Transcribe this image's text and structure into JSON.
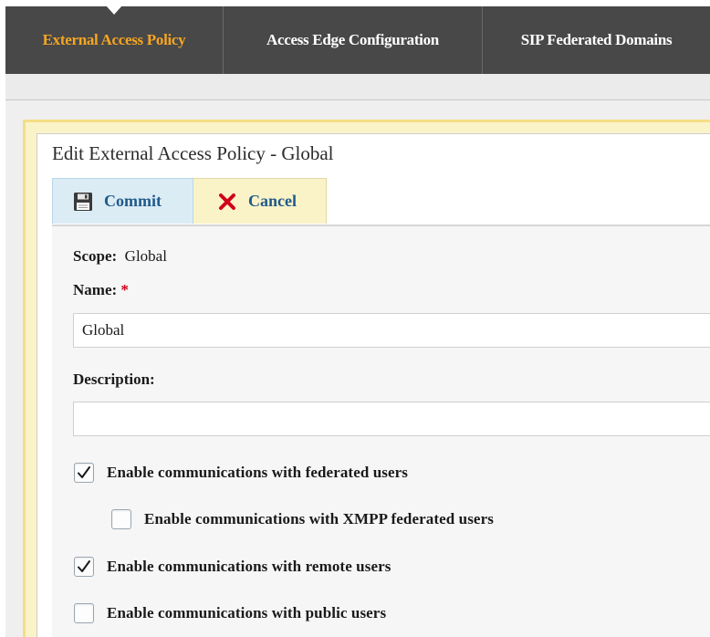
{
  "tabs": [
    {
      "label": "External Access Policy",
      "active": true
    },
    {
      "label": "Access Edge Configuration",
      "active": false
    },
    {
      "label": "SIP Federated Domains",
      "active": false
    }
  ],
  "panel": {
    "title": "Edit External Access Policy - Global"
  },
  "toolbar": {
    "commit_label": "Commit",
    "cancel_label": "Cancel"
  },
  "form": {
    "scope_label": "Scope:",
    "scope_value": "Global",
    "name_label": "Name:",
    "required_marker": "*",
    "name_value": "Global",
    "description_label": "Description:",
    "description_value": "",
    "checkboxes": [
      {
        "label": "Enable communications with federated users",
        "checked": true
      },
      {
        "label": "Enable communications with XMPP federated users",
        "checked": false
      },
      {
        "label": "Enable communications with remote users",
        "checked": true
      },
      {
        "label": "Enable communications with public users",
        "checked": false
      }
    ]
  },
  "colors": {
    "tabbar_bg": "#484848",
    "active_tab_text": "#f5a623",
    "button_text": "#1f5a8a",
    "cancel_icon": "#d0021b",
    "required": "#d0021b"
  }
}
